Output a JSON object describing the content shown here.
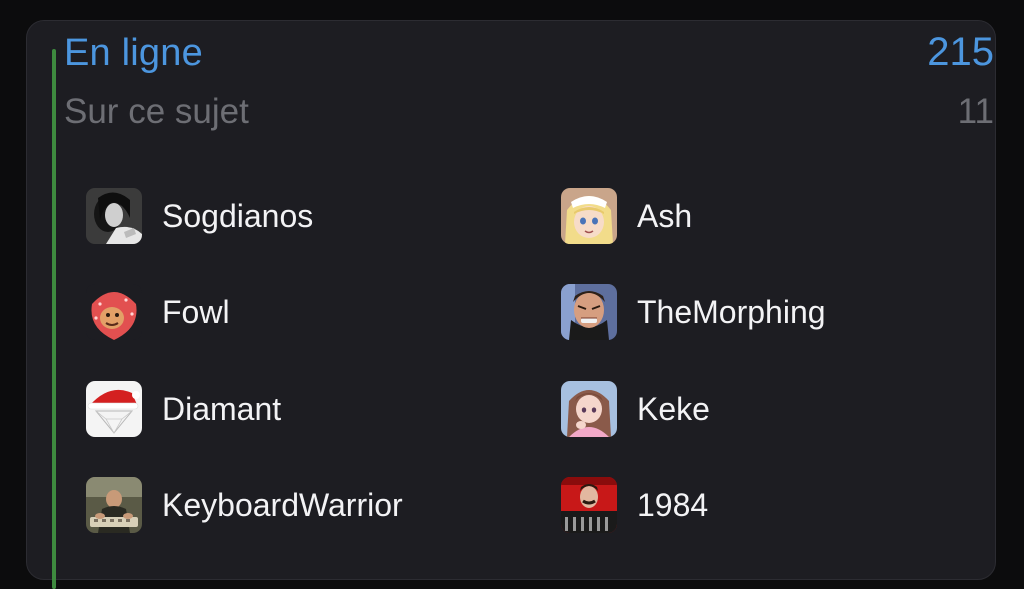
{
  "online": {
    "label": "En ligne",
    "count": "215"
  },
  "topic": {
    "label": "Sur ce sujet",
    "count": "11"
  },
  "users": [
    {
      "name": "Sogdianos",
      "avatar": "bw-portrait-avatar"
    },
    {
      "name": "Ash",
      "avatar": "anime-blonde-girl-avatar"
    },
    {
      "name": "Fowl",
      "avatar": "strawberry-face-avatar"
    },
    {
      "name": "TheMorphing",
      "avatar": "grimacing-man-avatar"
    },
    {
      "name": "Diamant",
      "avatar": "santa-hat-diamond-avatar"
    },
    {
      "name": "Keke",
      "avatar": "anime-pink-girl-avatar"
    },
    {
      "name": "KeyboardWarrior",
      "avatar": "man-typing-avatar"
    },
    {
      "name": "1984",
      "avatar": "red-poster-avatar"
    }
  ],
  "colors": {
    "accent_blue": "#4c96df",
    "accent_green": "#3e8a3f",
    "card_bg": "#1d1d22",
    "muted_text": "#6d6e74"
  }
}
